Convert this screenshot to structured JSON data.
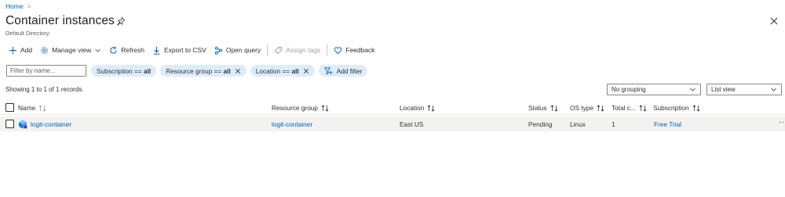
{
  "breadcrumb": {
    "home": "Home",
    "separator": ">"
  },
  "header": {
    "title": "Container instances",
    "subtitle": "Default Directory"
  },
  "toolbar": {
    "add": "Add",
    "manage_view": "Manage view",
    "refresh": "Refresh",
    "export_csv": "Export to CSV",
    "open_query": "Open query",
    "assign_tags": "Assign tags",
    "feedback": "Feedback"
  },
  "filters": {
    "search_placeholder": "Filter by name...",
    "subscription_label": "Subscription == ",
    "subscription_value": "all",
    "resource_group_label": "Resource group == ",
    "resource_group_value": "all",
    "location_label": "Location == ",
    "location_value": "all",
    "add_filter": "Add filter"
  },
  "records_text": "Showing 1 to 1 of 1 records.",
  "grouping": {
    "selected": "No grouping"
  },
  "view": {
    "selected": "List view"
  },
  "table": {
    "columns": {
      "name": "Name",
      "resource_group": "Resource group",
      "location": "Location",
      "status": "Status",
      "os_type": "OS type",
      "total": "Total c...",
      "subscription": "Subscription"
    },
    "rows": [
      {
        "name": "logit-container",
        "resource_group": "logit-container",
        "location": "East US",
        "status": "Pending",
        "os_type": "Linux",
        "total": "1",
        "subscription": "Free Trial",
        "more": "···"
      }
    ]
  },
  "colors": {
    "link": "#0062ad",
    "pill_bg": "#deecf9",
    "row_selected_bg": "#f3f2f1"
  }
}
